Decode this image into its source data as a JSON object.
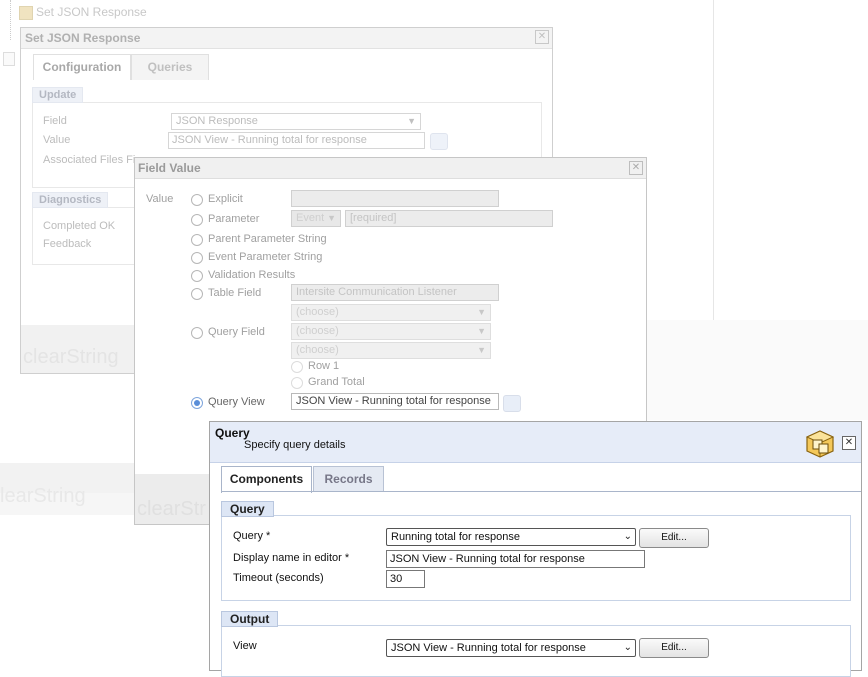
{
  "background": {
    "tree_node_label": "Set JSON Response",
    "faded_text_left": "clearString"
  },
  "set_json_dialog": {
    "title": "Set JSON Response",
    "tabs": [
      {
        "label": "Configuration",
        "active": true
      },
      {
        "label": "Queries",
        "active": false
      }
    ],
    "update_group": {
      "heading": "Update",
      "field_label": "Field",
      "field_value": "JSON Response",
      "value_label": "Value",
      "value_text": "JSON View - Running total for response",
      "assoc_label": "Associated Files Fi"
    },
    "diagnostics_group": {
      "heading": "Diagnostics",
      "completed_label": "Completed OK",
      "feedback_label": "Feedback"
    },
    "footer_faded_text": "clearString"
  },
  "field_value_dialog": {
    "title": "Field Value",
    "value_label": "Value",
    "options": {
      "explicit": "Explicit",
      "parameter": "Parameter",
      "parent_param": "Parent Parameter String",
      "event_param": "Event Parameter String",
      "validation": "Validation Results",
      "table_field": "Table Field",
      "query_field": "Query Field",
      "query_view": "Query View"
    },
    "selected_option": "query_view",
    "parameter_select": "Event",
    "parameter_required": "[required]",
    "table_field_value": "Intersite Communication Listener",
    "choose_placeholder": "(choose)",
    "row_option": "Row 1",
    "grand_total_option": "Grand Total",
    "query_view_value": "JSON View - Running total for response",
    "footer_faded_text": "clearStr"
  },
  "query_dialog": {
    "title": "Query",
    "subtitle": "Specify query details",
    "icon": "cube-box-icon",
    "tabs": [
      {
        "label": "Components",
        "active": true
      },
      {
        "label": "Records",
        "active": false
      }
    ],
    "query_group": {
      "heading": "Query",
      "query_label": "Query *",
      "query_value": "Running total for response",
      "edit_label": "Edit...",
      "display_name_label": "Display name in editor *",
      "display_name_value": "JSON View - Running total for response",
      "timeout_label": "Timeout (seconds)",
      "timeout_value": "30"
    },
    "output_group": {
      "heading": "Output",
      "view_label": "View",
      "view_value": "JSON View - Running total for response",
      "edit_label": "Edit..."
    }
  }
}
